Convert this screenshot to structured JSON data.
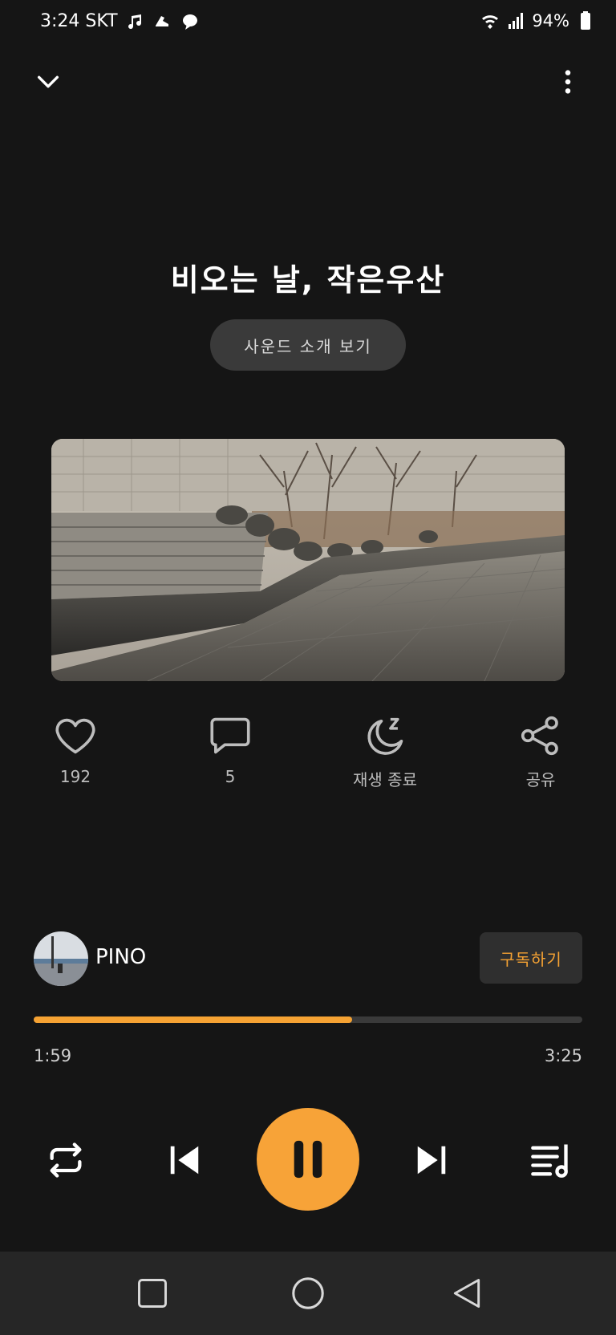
{
  "status_bar": {
    "time_carrier": "3:24 SKT",
    "battery": "94%",
    "icons": [
      "music-note-icon",
      "sneaker-icon",
      "chat-bubble-icon",
      "wifi-icon",
      "signal-icon",
      "battery-icon"
    ]
  },
  "top_bar": {
    "collapse_icon": "chevron-down-icon",
    "more_icon": "more-vertical-icon"
  },
  "track": {
    "title": "비오는 날, 작은우산",
    "intro_button_label": "사운드 소개 보기",
    "artwork": "stream-walkway-photo"
  },
  "actions": [
    {
      "icon": "heart-icon",
      "label": "192"
    },
    {
      "icon": "comment-icon",
      "label": "5"
    },
    {
      "icon": "sleep-timer-icon",
      "label": "재생 종료"
    },
    {
      "icon": "share-icon",
      "label": "공유"
    }
  ],
  "channel": {
    "name": "PINO",
    "subscribe_label": "구독하기"
  },
  "progress": {
    "elapsed": "1:59",
    "total": "3:25",
    "fraction": 0.58
  },
  "controls": {
    "repeat_icon": "repeat-icon",
    "previous_icon": "skip-previous-icon",
    "play_pause_icon": "pause-icon",
    "next_icon": "skip-next-icon",
    "playlist_icon": "playlist-icon"
  },
  "nav_bar": {
    "icons": [
      "recent-apps-icon",
      "home-icon",
      "back-icon"
    ]
  },
  "colors": {
    "background": "#151515",
    "accent": "#F5A233",
    "button_bg": "#3A3A3A",
    "nav_bg": "#262626"
  }
}
